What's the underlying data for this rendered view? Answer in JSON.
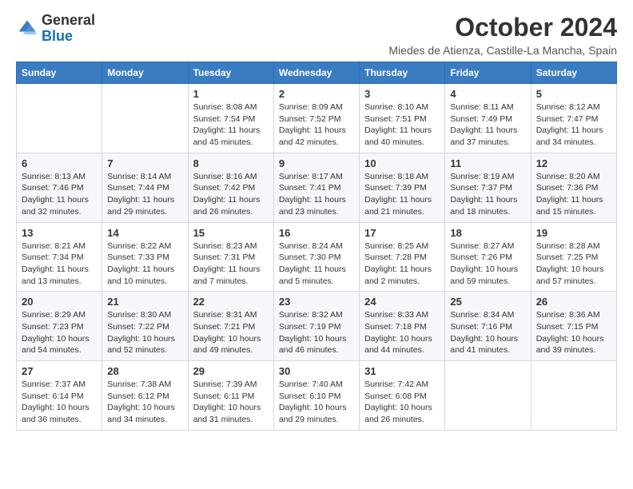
{
  "logo": {
    "general": "General",
    "blue": "Blue"
  },
  "title": "October 2024",
  "location": "Miedes de Atienza, Castille-La Mancha, Spain",
  "days_of_week": [
    "Sunday",
    "Monday",
    "Tuesday",
    "Wednesday",
    "Thursday",
    "Friday",
    "Saturday"
  ],
  "weeks": [
    [
      {
        "day": "",
        "info": ""
      },
      {
        "day": "",
        "info": ""
      },
      {
        "day": "1",
        "info": "Sunrise: 8:08 AM\nSunset: 7:54 PM\nDaylight: 11 hours and 45 minutes."
      },
      {
        "day": "2",
        "info": "Sunrise: 8:09 AM\nSunset: 7:52 PM\nDaylight: 11 hours and 42 minutes."
      },
      {
        "day": "3",
        "info": "Sunrise: 8:10 AM\nSunset: 7:51 PM\nDaylight: 11 hours and 40 minutes."
      },
      {
        "day": "4",
        "info": "Sunrise: 8:11 AM\nSunset: 7:49 PM\nDaylight: 11 hours and 37 minutes."
      },
      {
        "day": "5",
        "info": "Sunrise: 8:12 AM\nSunset: 7:47 PM\nDaylight: 11 hours and 34 minutes."
      }
    ],
    [
      {
        "day": "6",
        "info": "Sunrise: 8:13 AM\nSunset: 7:46 PM\nDaylight: 11 hours and 32 minutes."
      },
      {
        "day": "7",
        "info": "Sunrise: 8:14 AM\nSunset: 7:44 PM\nDaylight: 11 hours and 29 minutes."
      },
      {
        "day": "8",
        "info": "Sunrise: 8:16 AM\nSunset: 7:42 PM\nDaylight: 11 hours and 26 minutes."
      },
      {
        "day": "9",
        "info": "Sunrise: 8:17 AM\nSunset: 7:41 PM\nDaylight: 11 hours and 23 minutes."
      },
      {
        "day": "10",
        "info": "Sunrise: 8:18 AM\nSunset: 7:39 PM\nDaylight: 11 hours and 21 minutes."
      },
      {
        "day": "11",
        "info": "Sunrise: 8:19 AM\nSunset: 7:37 PM\nDaylight: 11 hours and 18 minutes."
      },
      {
        "day": "12",
        "info": "Sunrise: 8:20 AM\nSunset: 7:36 PM\nDaylight: 11 hours and 15 minutes."
      }
    ],
    [
      {
        "day": "13",
        "info": "Sunrise: 8:21 AM\nSunset: 7:34 PM\nDaylight: 11 hours and 13 minutes."
      },
      {
        "day": "14",
        "info": "Sunrise: 8:22 AM\nSunset: 7:33 PM\nDaylight: 11 hours and 10 minutes."
      },
      {
        "day": "15",
        "info": "Sunrise: 8:23 AM\nSunset: 7:31 PM\nDaylight: 11 hours and 7 minutes."
      },
      {
        "day": "16",
        "info": "Sunrise: 8:24 AM\nSunset: 7:30 PM\nDaylight: 11 hours and 5 minutes."
      },
      {
        "day": "17",
        "info": "Sunrise: 8:25 AM\nSunset: 7:28 PM\nDaylight: 11 hours and 2 minutes."
      },
      {
        "day": "18",
        "info": "Sunrise: 8:27 AM\nSunset: 7:26 PM\nDaylight: 10 hours and 59 minutes."
      },
      {
        "day": "19",
        "info": "Sunrise: 8:28 AM\nSunset: 7:25 PM\nDaylight: 10 hours and 57 minutes."
      }
    ],
    [
      {
        "day": "20",
        "info": "Sunrise: 8:29 AM\nSunset: 7:23 PM\nDaylight: 10 hours and 54 minutes."
      },
      {
        "day": "21",
        "info": "Sunrise: 8:30 AM\nSunset: 7:22 PM\nDaylight: 10 hours and 52 minutes."
      },
      {
        "day": "22",
        "info": "Sunrise: 8:31 AM\nSunset: 7:21 PM\nDaylight: 10 hours and 49 minutes."
      },
      {
        "day": "23",
        "info": "Sunrise: 8:32 AM\nSunset: 7:19 PM\nDaylight: 10 hours and 46 minutes."
      },
      {
        "day": "24",
        "info": "Sunrise: 8:33 AM\nSunset: 7:18 PM\nDaylight: 10 hours and 44 minutes."
      },
      {
        "day": "25",
        "info": "Sunrise: 8:34 AM\nSunset: 7:16 PM\nDaylight: 10 hours and 41 minutes."
      },
      {
        "day": "26",
        "info": "Sunrise: 8:36 AM\nSunset: 7:15 PM\nDaylight: 10 hours and 39 minutes."
      }
    ],
    [
      {
        "day": "27",
        "info": "Sunrise: 7:37 AM\nSunset: 6:14 PM\nDaylight: 10 hours and 36 minutes."
      },
      {
        "day": "28",
        "info": "Sunrise: 7:38 AM\nSunset: 6:12 PM\nDaylight: 10 hours and 34 minutes."
      },
      {
        "day": "29",
        "info": "Sunrise: 7:39 AM\nSunset: 6:11 PM\nDaylight: 10 hours and 31 minutes."
      },
      {
        "day": "30",
        "info": "Sunrise: 7:40 AM\nSunset: 6:10 PM\nDaylight: 10 hours and 29 minutes."
      },
      {
        "day": "31",
        "info": "Sunrise: 7:42 AM\nSunset: 6:08 PM\nDaylight: 10 hours and 26 minutes."
      },
      {
        "day": "",
        "info": ""
      },
      {
        "day": "",
        "info": ""
      }
    ]
  ]
}
